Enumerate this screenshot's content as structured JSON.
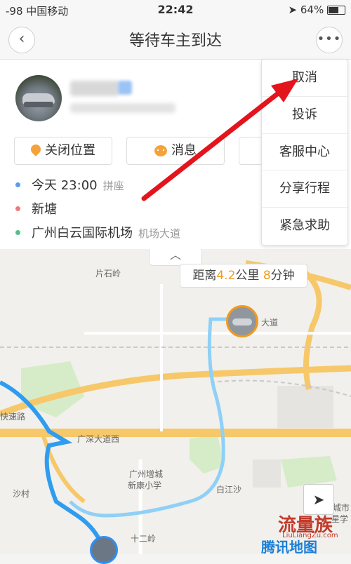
{
  "status_bar": {
    "carrier": "-98 中国移动",
    "time": "22:42",
    "battery": "64%"
  },
  "header": {
    "title": "等待车主到达",
    "back_icon": "chevron-left-icon",
    "more_icon": "ellipsis-icon"
  },
  "actions": {
    "location_label": "关闭位置",
    "message_label": "消息"
  },
  "trip": {
    "time": "今天 23:00",
    "ride_type": "拼座",
    "start": "新塘",
    "destination": "广州白云国际机场",
    "destination_sub": "机场大道",
    "colors": {
      "time_dot": "#5b9bf0",
      "start_dot": "#f07a7a",
      "dest_dot": "#4fc08d"
    }
  },
  "menu": {
    "items": [
      "取消",
      "投诉",
      "客服中心",
      "分享行程",
      "紧急求助"
    ]
  },
  "map": {
    "eta_prefix": "距离",
    "distance": "4.2",
    "distance_unit": "公里",
    "minutes": "8",
    "minutes_unit": "分钟",
    "labels": {
      "shishiling": "片石岭",
      "dadao": "大道",
      "kuaisulu": "快速路",
      "guangshen": "广深大道西",
      "school1": "广州增城",
      "school2": "新康小学",
      "baijiangsha": "白江沙",
      "shacun": "沙村",
      "shierling": "十二岭",
      "chengshi": "城市",
      "xingxue": "星学"
    },
    "logo": "腾讯地图",
    "watermark": "流量族",
    "watermark_url": "LiuLiangZu.com",
    "accent": "#f39a1e",
    "route_color": "#2f9cf0"
  }
}
